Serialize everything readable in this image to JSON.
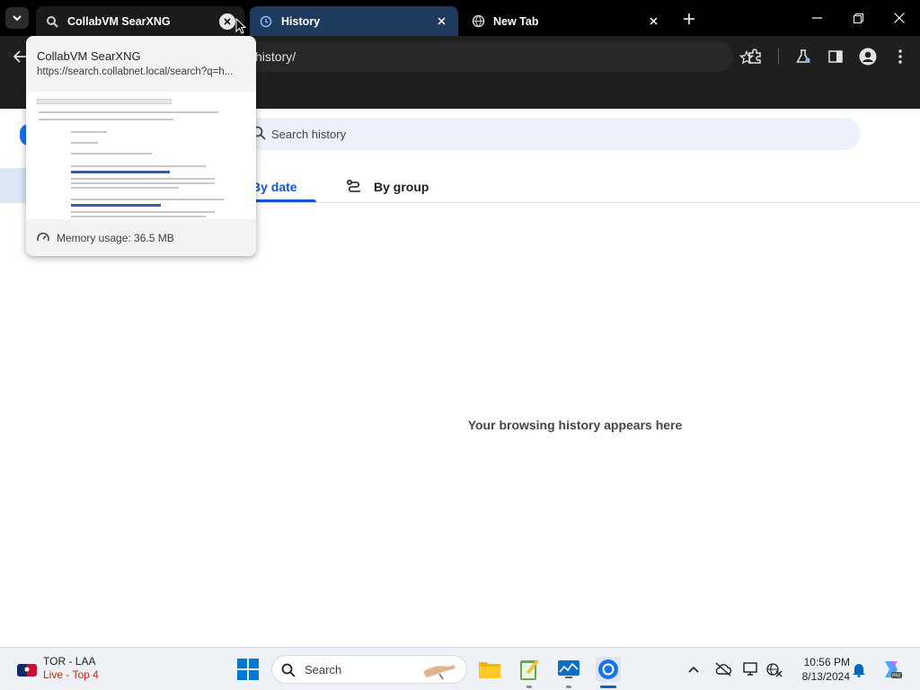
{
  "browser": {
    "tabs": [
      {
        "title": "CollabVM SearXNG",
        "favicon": "searxng-icon",
        "active": false
      },
      {
        "title": "History",
        "favicon": "history-icon",
        "active": true
      },
      {
        "title": "New Tab",
        "favicon": "chrome-globe-icon",
        "active": false
      }
    ],
    "omnibox_text": "history/"
  },
  "hover_card": {
    "title": "CollabVM SearXNG",
    "url": "https://search.collabnet.local/search?q=h...",
    "memory_label": "Memory usage: 36.5 MB"
  },
  "history_page": {
    "search_placeholder": "Search history",
    "tabs": [
      {
        "label": "By date",
        "selected": true
      },
      {
        "label": "By group",
        "selected": false
      }
    ],
    "empty_message": "Your browsing history appears here"
  },
  "taskbar": {
    "widget_line1": "TOR - LAA",
    "widget_line2": "Live - Top 4",
    "search_label": "Search",
    "time": "10:56 PM",
    "date": "8/13/2024"
  },
  "colors": {
    "accent": "#0b57d0",
    "live_red": "#c42b1c",
    "active_tab": "#1f3a5f"
  }
}
